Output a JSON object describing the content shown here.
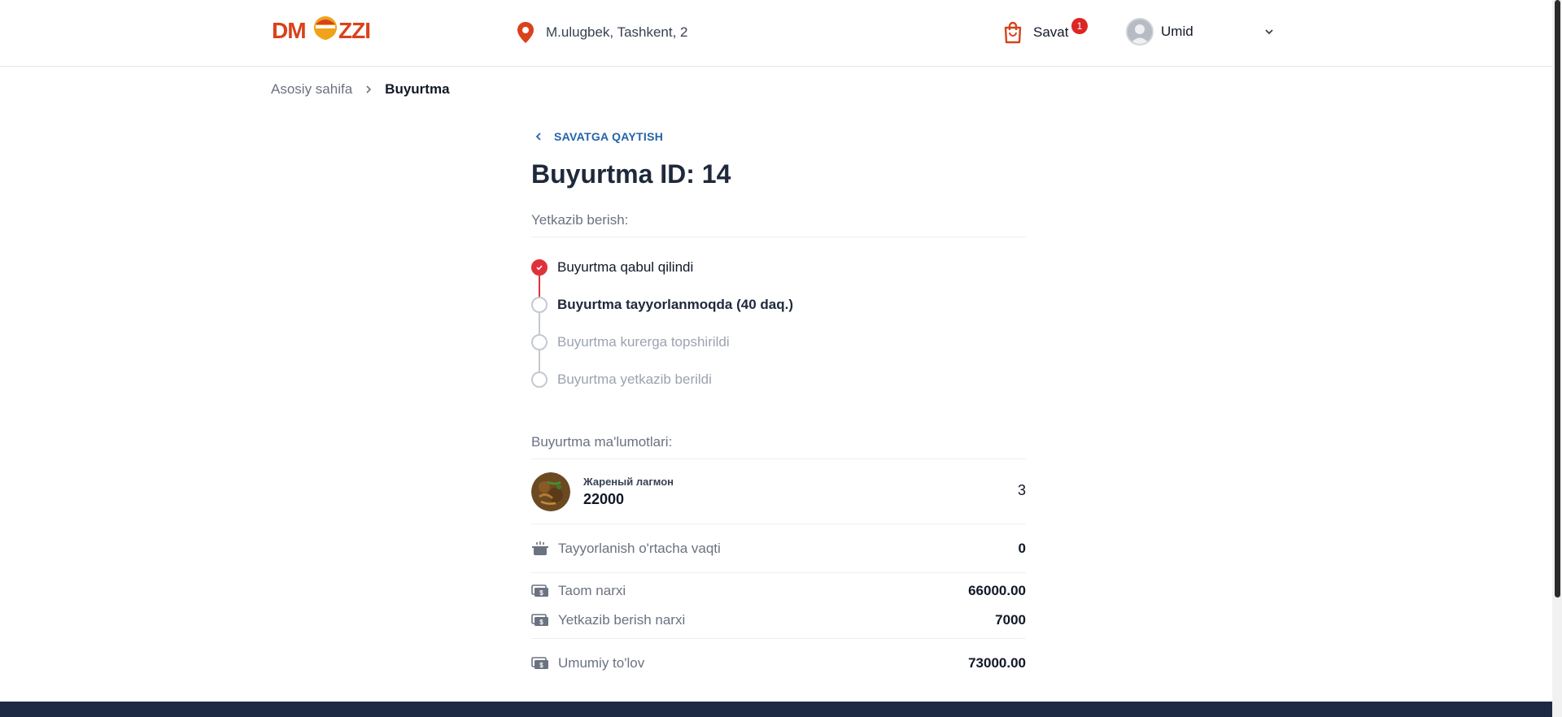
{
  "header": {
    "logo_text": "DMAZZI",
    "location": "M.ulugbek, Tashkent, 2",
    "cart_label": "Savat",
    "cart_count": "1",
    "user_name": "Umid"
  },
  "breadcrumb": {
    "home": "Asosiy sahifa",
    "current": "Buyurtma"
  },
  "order": {
    "back_label": "SAVATGA QAYTISH",
    "title": "Buyurtma ID: 14",
    "delivery_title": "Yetkazib berish:",
    "steps": [
      {
        "label": "Buyurtma qabul qilindi",
        "status": "done"
      },
      {
        "label": "Buyurtma tayyorlanmoqda (40 daq.)",
        "status": "active"
      },
      {
        "label": "Buyurtma kurerga topshirildi",
        "status": "pending"
      },
      {
        "label": "Buyurtma yetkazib berildi",
        "status": "pending"
      }
    ],
    "info_title": "Buyurtma ma'lumotlari:",
    "items": [
      {
        "name": "Жареный лагмон",
        "price": "22000",
        "qty": "3"
      }
    ],
    "avg_time_label": "Tayyorlanish o'rtacha vaqti",
    "avg_time_value": "0",
    "food_price_label": "Taom narxi",
    "food_price_value": "66000.00",
    "delivery_price_label": "Yetkazib berish narxi",
    "delivery_price_value": "7000",
    "total_label": "Umumiy to'lov",
    "total_value": "73000.00"
  },
  "colors": {
    "accent": "#e0313b",
    "link": "#2563a8",
    "footer": "#1e2a44",
    "logo_orange": "#e8591a"
  }
}
